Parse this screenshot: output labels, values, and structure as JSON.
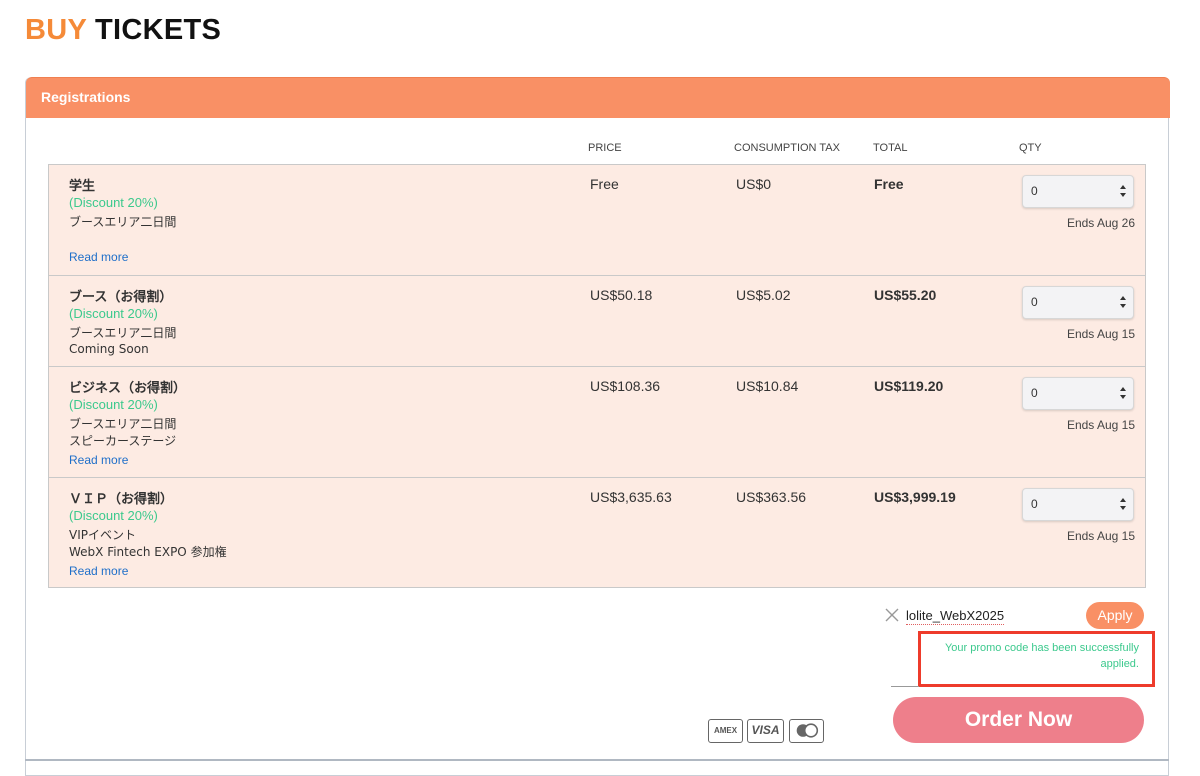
{
  "page": {
    "title_accent": "BUY",
    "title_main": "TICKETS"
  },
  "panel": {
    "header": "Registrations"
  },
  "columns": {
    "price": "PRICE",
    "tax": "CONSUMPTION TAX",
    "total": "TOTAL",
    "qty": "QTY"
  },
  "tickets": [
    {
      "name": "学生",
      "discount": "(Discount 20%)",
      "desc_1": "ブースエリア二日間",
      "desc_2": "",
      "link": "Read more",
      "price": "Free",
      "tax": "US$0",
      "total": "Free",
      "qty": "0",
      "ends": "Ends Aug 26"
    },
    {
      "name": "ブース（お得割）",
      "discount": "(Discount 20%)",
      "desc_1": "ブースエリア二日間",
      "desc_2": "Coming Soon",
      "link": "",
      "price": "US$50.18",
      "tax": "US$5.02",
      "total": "US$55.20",
      "qty": "0",
      "ends": "Ends Aug 15"
    },
    {
      "name": "ビジネス（お得割）",
      "discount": "(Discount 20%)",
      "desc_1": "ブースエリア二日間",
      "desc_2": "スピーカーステージ",
      "link": "Read more",
      "price": "US$108.36",
      "tax": "US$10.84",
      "total": "US$119.20",
      "qty": "0",
      "ends": "Ends Aug 15"
    },
    {
      "name": "ＶＩＰ（お得割）",
      "discount": "(Discount 20%)",
      "desc_1": "VIPイベント",
      "desc_2": "WebX Fintech EXPO 参加権",
      "link": "Read more",
      "price": "US$3,635.63",
      "tax": "US$363.56",
      "total": "US$3,999.19",
      "qty": "0",
      "ends": "Ends Aug 15"
    }
  ],
  "promo": {
    "code": "lolite_WebX2025",
    "apply_label": "Apply",
    "message_line1": "Your promo code has been successfully",
    "message_line2": "applied."
  },
  "payment": {
    "amex": "AMEX",
    "visa": "VISA"
  },
  "order": {
    "label": "Order Now"
  },
  "colors": {
    "accent": "#f58a38",
    "header": "#f99065",
    "row_bg": "#fdebe3",
    "discount": "#3cc98d",
    "order_button": "#ee7f8b",
    "highlight_box": "#ee3b2b"
  }
}
